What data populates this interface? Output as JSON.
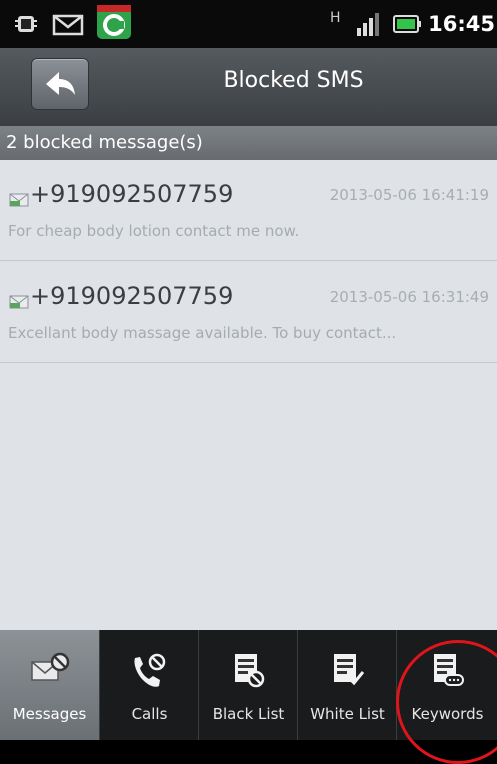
{
  "status_bar": {
    "time": "16:45",
    "network_label": "H",
    "icons": [
      "android-debug-icon",
      "mail-notification-icon",
      "comodo-app-icon",
      "network-h-icon",
      "signal-icon",
      "battery-icon"
    ],
    "accent_green": "#2fa34a"
  },
  "header": {
    "title": "Blocked SMS",
    "back_icon": "back-arrow-icon"
  },
  "list": {
    "count_label": "2 blocked message(s)",
    "messages": [
      {
        "sender": "+919092507759",
        "time": "2013-05-06 16:41:19",
        "preview": "For cheap body lotion contact me now."
      },
      {
        "sender": "+919092507759",
        "time": "2013-05-06 16:31:49",
        "preview": "Excellant body massage available. To buy contact..."
      }
    ]
  },
  "tabs": [
    {
      "label": "Messages",
      "icon": "message-blocked-icon",
      "active": true
    },
    {
      "label": "Calls",
      "icon": "phone-blocked-icon",
      "active": false
    },
    {
      "label": "Black List",
      "icon": "blacklist-icon",
      "active": false
    },
    {
      "label": "White List",
      "icon": "whitelist-icon",
      "active": false
    },
    {
      "label": "Keywords",
      "icon": "keywords-icon",
      "active": false
    }
  ],
  "colors": {
    "highlight": "#e0141b",
    "list_background": "#dfe3e7",
    "title_bar": "#4a4e52"
  }
}
